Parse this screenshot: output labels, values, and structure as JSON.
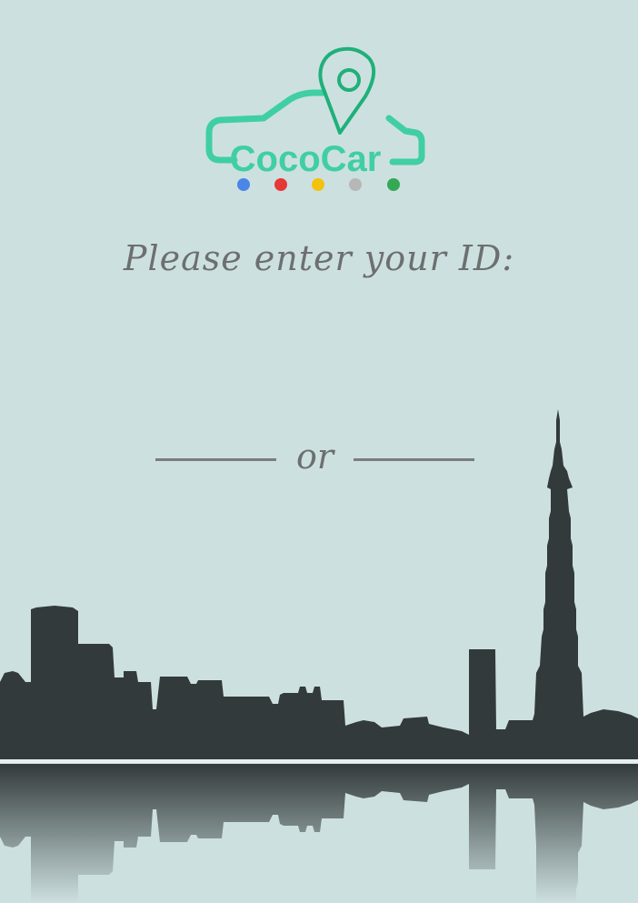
{
  "app": {
    "brand_name": "CocoCar",
    "brand_color": "#3fcfa3",
    "pin_color": "#1fb07a",
    "dots": [
      "#4a86e8",
      "#e53935",
      "#f4c20d",
      "#b7b7b7",
      "#34a853"
    ]
  },
  "login": {
    "prompt": "Please enter your ID:",
    "id_value": "",
    "separator": "or"
  },
  "colors": {
    "background": "#cde0e0",
    "skyline": "#333a3b",
    "text": "#6c6f70"
  }
}
